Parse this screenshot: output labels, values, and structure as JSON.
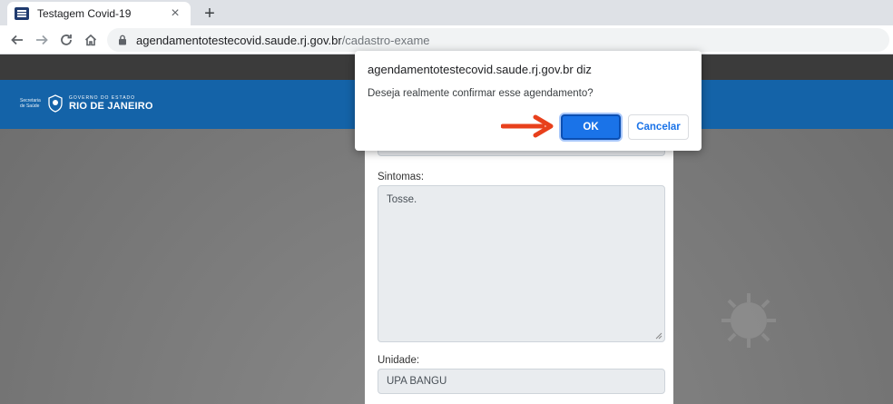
{
  "browser": {
    "tab_title": "Testagem Covid-19",
    "close_glyph": "×",
    "new_tab_glyph": "+",
    "url_host": "agendamentotestecovid.saude.rj.gov.br",
    "url_path": "/cadastro-exame"
  },
  "header": {
    "small_text": "Secretaria de Saúde",
    "gov_top": "GOVERNO DO ESTADO",
    "gov_name": "RIO DE JANEIRO"
  },
  "form": {
    "symptoms_label": "Sintomas:",
    "symptoms_value": "Tosse.",
    "unit_label": "Unidade:",
    "unit_value": "UPA BANGU"
  },
  "dialog": {
    "title": "agendamentotestecovid.saude.rj.gov.br diz",
    "message": "Deseja realmente confirmar esse agendamento?",
    "ok_label": "OK",
    "cancel_label": "Cancelar"
  },
  "colors": {
    "header_blue": "#1463a8",
    "ok_blue": "#1a73e8",
    "arrow_red": "#e8401c"
  },
  "icons": [
    "favicon-icon",
    "close-icon",
    "plus-icon",
    "back-icon",
    "forward-icon",
    "reload-icon",
    "home-icon",
    "lock-icon",
    "seal-icon",
    "virus-icon",
    "resize-icon",
    "arrow-icon"
  ]
}
